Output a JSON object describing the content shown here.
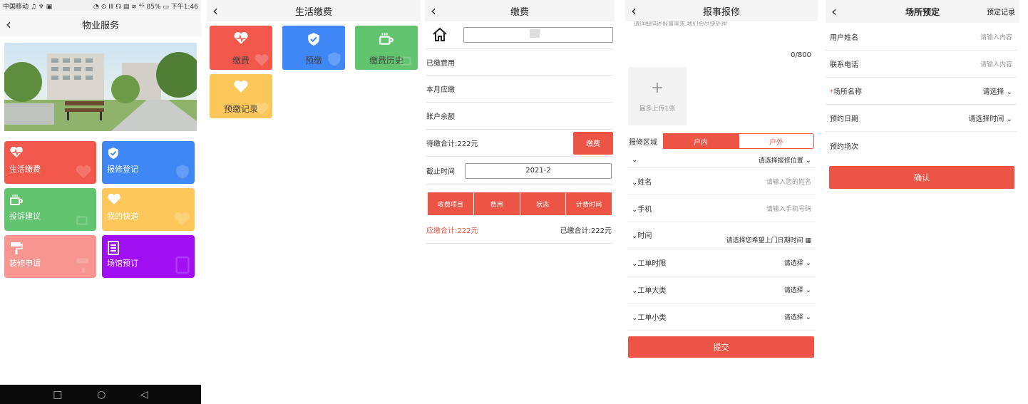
{
  "panel1": {
    "statusbar": {
      "carrier": "中国移动 ♫ ♆ ▣",
      "right": "◔ ⊙ ⅠⅡ ☊ ▤ ≋ ⁴ᴳ 85% ▭ 下午1:46"
    },
    "title": "物业服务",
    "back": "‹",
    "tiles": [
      {
        "label": "生活缴费",
        "icon": "heart-pulse-icon",
        "color": "#f2574c"
      },
      {
        "label": "报修登记",
        "icon": "shield-check-icon",
        "color": "#3f87f5"
      },
      {
        "label": "投诉建议",
        "icon": "cup-icon",
        "color": "#63c46f"
      },
      {
        "label": "我的快递",
        "icon": "heart-icon",
        "color": "#fdc75a"
      },
      {
        "label": "装修申请",
        "icon": "paint-roller-icon",
        "color": "#f79590"
      },
      {
        "label": "场馆预订",
        "icon": "list-icon",
        "color": "#a00ff2"
      }
    ],
    "nav": {
      "square": "□",
      "circle": "○",
      "back": "◁"
    }
  },
  "panel2": {
    "title": "生活缴费",
    "back": "‹",
    "tiles": [
      {
        "label": "缴费",
        "icon": "heart-pulse-icon",
        "color": "#f2574c"
      },
      {
        "label": "预缴",
        "icon": "shield-check-icon",
        "color": "#3f87f5"
      },
      {
        "label": "缴费历史",
        "icon": "cup-icon",
        "color": "#63c46f"
      },
      {
        "label": "预缴记录",
        "icon": "heart-icon",
        "color": "#fdc75a"
      }
    ]
  },
  "panel3": {
    "title": "缴费",
    "back": "‹",
    "rows": {
      "paid": "已缴费用",
      "due_month": "本月应缴",
      "balance": "账户余额"
    },
    "pending_total": "待缴合计:222元",
    "pay_button": "缴费",
    "deadline_label": "截止时间",
    "deadline_value": "2021-2",
    "table_headers": [
      "收费项目",
      "费用",
      "状态",
      "计费时间"
    ],
    "due_total": "应缴合计:222元",
    "paid_total": "已缴合计:222元"
  },
  "panel4": {
    "title": "报事报修",
    "back": "‹",
    "top_text": "请详细描述报事需求,我们会尽快处理",
    "counter": "0/800",
    "upload_text": "最多上传1张",
    "area_label": "报修区域",
    "area_options": [
      "户内",
      "户外"
    ],
    "location_placeholder": "请选择报修位置",
    "name_label": "姓名",
    "name_placeholder": "请输入您的姓名",
    "phone_label": "手机",
    "phone_placeholder": "请输入手机号码",
    "time_label": "时间",
    "time_placeholder": "请选择您希望上门日期时间",
    "limit_label": "工单时限",
    "major_label": "工单大类",
    "minor_label": "工单小类",
    "select_text": "请选择",
    "submit": "提交",
    "accent": "#ec5445"
  },
  "panel5": {
    "title": "场所预定",
    "back": "‹",
    "right_link": "预定记录",
    "user_label": "用户姓名",
    "user_placeholder": "请输入内容",
    "phone_label": "联系电话",
    "phone_placeholder": "请输入内容",
    "required_mark": "*",
    "venue_label": "场所名称",
    "venue_select": "请选择",
    "date_label": "预约日期",
    "date_select": "请选择时间",
    "session_label": "预约场次",
    "confirm": "确认"
  }
}
